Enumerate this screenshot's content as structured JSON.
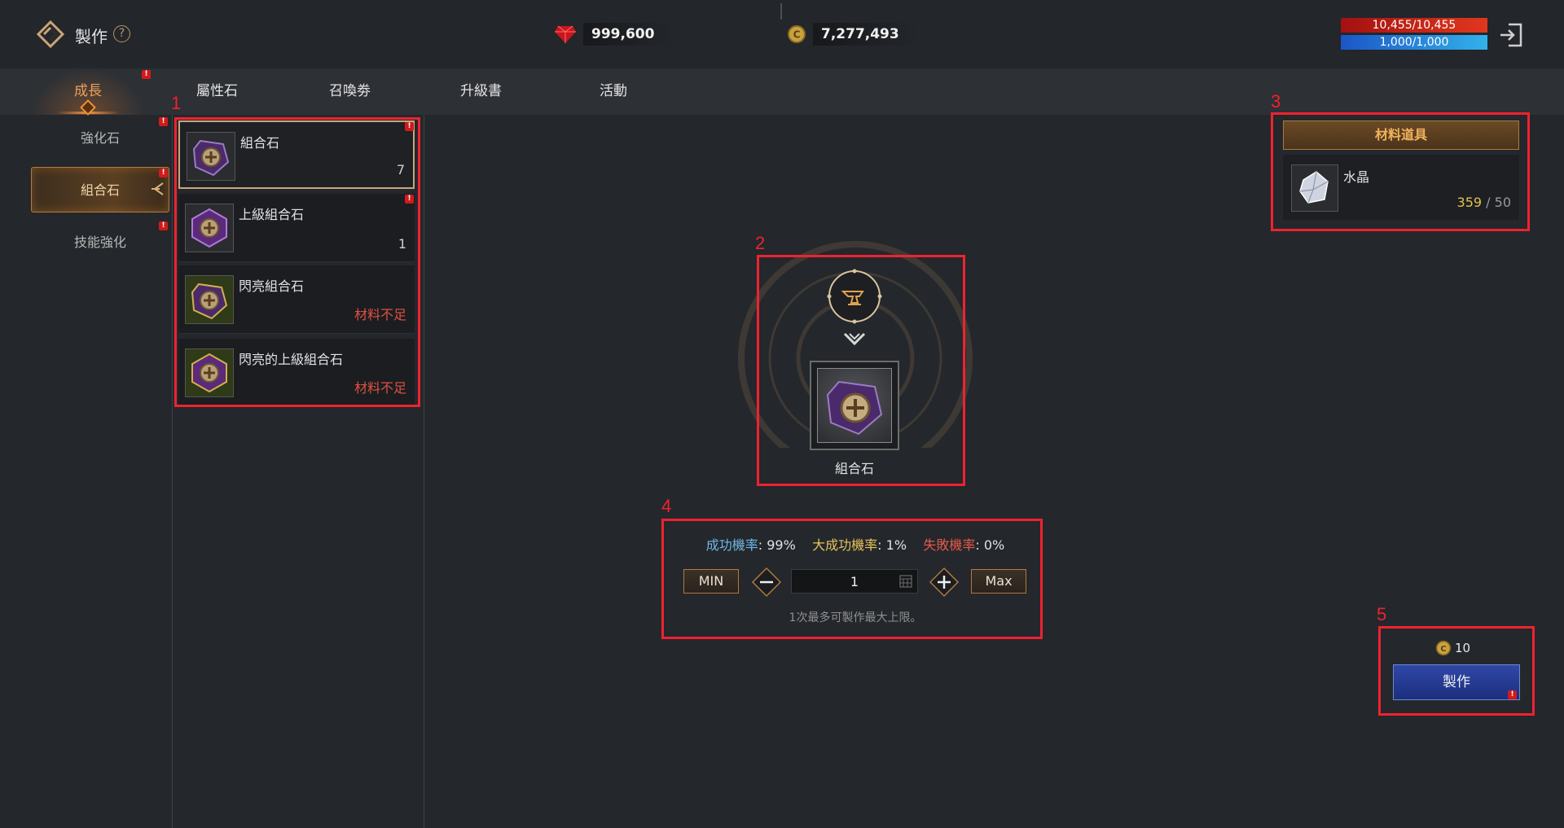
{
  "header": {
    "title": "製作",
    "help_symbol": "?",
    "currencies": [
      {
        "icon": "ruby-gem-icon",
        "amount": "999,600"
      },
      {
        "icon": "gold-coin-icon",
        "amount": "7,277,493"
      }
    ],
    "hp": "10,455/10,455",
    "mp": "1,000/1,000"
  },
  "tabs": {
    "main": "成長",
    "sub": [
      "屬性石",
      "召喚劵",
      "升級書",
      "活動"
    ]
  },
  "sidebar": {
    "items": [
      {
        "label": "強化石",
        "active": false
      },
      {
        "label": "組合石",
        "active": true
      },
      {
        "label": "技能強化",
        "active": false
      }
    ]
  },
  "badge_symbol": "!",
  "recipes": [
    {
      "name": "組合石",
      "count": "7",
      "status": "",
      "selected": true
    },
    {
      "name": "上級組合石",
      "count": "1",
      "status": "",
      "selected": false
    },
    {
      "name": "閃亮組合石",
      "count": "",
      "status": "材料不足",
      "selected": false
    },
    {
      "name": "閃亮的上級組合石",
      "count": "",
      "status": "材料不足",
      "selected": false
    }
  ],
  "materials": {
    "header": "材料道具",
    "items": [
      {
        "name": "水晶",
        "have": "359",
        "separator": " / ",
        "need": "50"
      }
    ]
  },
  "product": {
    "name": "組合石"
  },
  "rates": {
    "success_label": "成功機率",
    "success_value": ": 99%",
    "great_label": "大成功機率",
    "great_value": ": 1%",
    "fail_label": "失敗機率",
    "fail_value": ": 0%"
  },
  "quantity": {
    "min_label": "MIN",
    "max_label": "Max",
    "value": "1",
    "note": "1次最多可製作最大上限。"
  },
  "craft": {
    "cost": "10",
    "button_label": "製作"
  },
  "annotations": [
    "1",
    "2",
    "3",
    "4",
    "5"
  ],
  "colors": {
    "annotation": "#ef2230",
    "accent_orange": "#e89240",
    "warning_red": "#e05140",
    "craft_blue": "#2f48a8"
  }
}
